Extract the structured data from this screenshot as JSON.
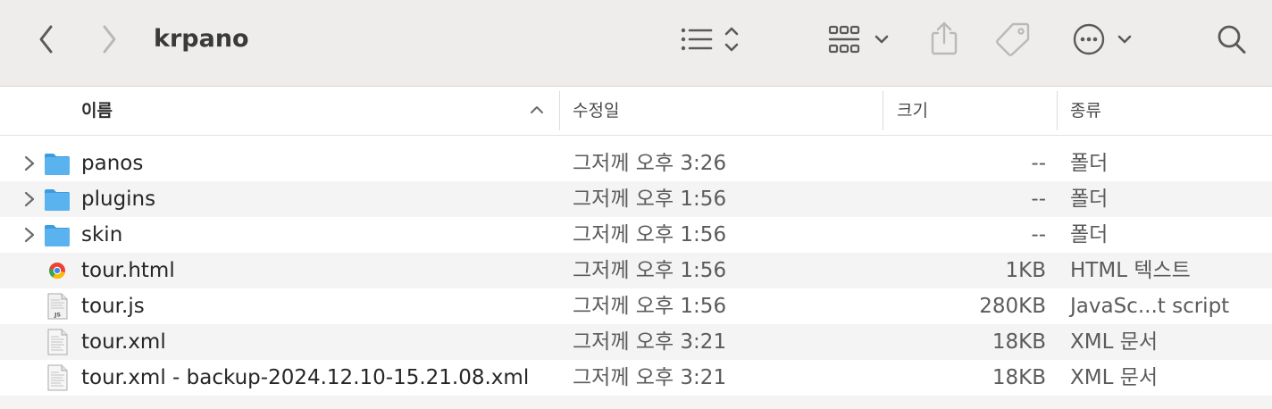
{
  "window": {
    "title": "krpano"
  },
  "toolbar": {
    "back_icon": "chevron-left-icon",
    "forward_icon": "chevron-right-icon",
    "view_options_icon": "list-view-icon",
    "group_icon": "group-grid-icon",
    "share_icon": "share-icon",
    "tag_icon": "tag-icon",
    "more_icon": "ellipsis-circle-icon",
    "search_icon": "magnifier-icon"
  },
  "columns": {
    "name": "이름",
    "modified": "수정일",
    "size": "크기",
    "kind": "종류",
    "sort_direction": "ascending"
  },
  "colors": {
    "folder": "#5ab3ee",
    "toolbar_bg": "#efedec",
    "row_alt": "#f4f4f4"
  },
  "files": [
    {
      "name": "panos",
      "modified": "그저께 오후 3:26",
      "size": "--",
      "kind": "폴더",
      "icon": "folder-icon",
      "expandable": true
    },
    {
      "name": "plugins",
      "modified": "그저께 오후 1:56",
      "size": "--",
      "kind": "폴더",
      "icon": "folder-icon",
      "expandable": true
    },
    {
      "name": "skin",
      "modified": "그저께 오후 1:56",
      "size": "--",
      "kind": "폴더",
      "icon": "folder-icon",
      "expandable": true
    },
    {
      "name": "tour.html",
      "modified": "그저께 오후 1:56",
      "size": "1KB",
      "kind": "HTML 텍스트",
      "icon": "chrome-html-icon",
      "expandable": false
    },
    {
      "name": "tour.js",
      "modified": "그저께 오후 1:56",
      "size": "280KB",
      "kind": "JavaSc...t script",
      "icon": "js-file-icon",
      "expandable": false
    },
    {
      "name": "tour.xml",
      "modified": "그저께 오후 3:21",
      "size": "18KB",
      "kind": "XML 문서",
      "icon": "xml-file-icon",
      "expandable": false
    },
    {
      "name": "tour.xml - backup-2024.12.10-15.21.08.xml",
      "modified": "그저께 오후 3:21",
      "size": "18KB",
      "kind": "XML 문서",
      "icon": "xml-file-icon",
      "expandable": false
    }
  ]
}
